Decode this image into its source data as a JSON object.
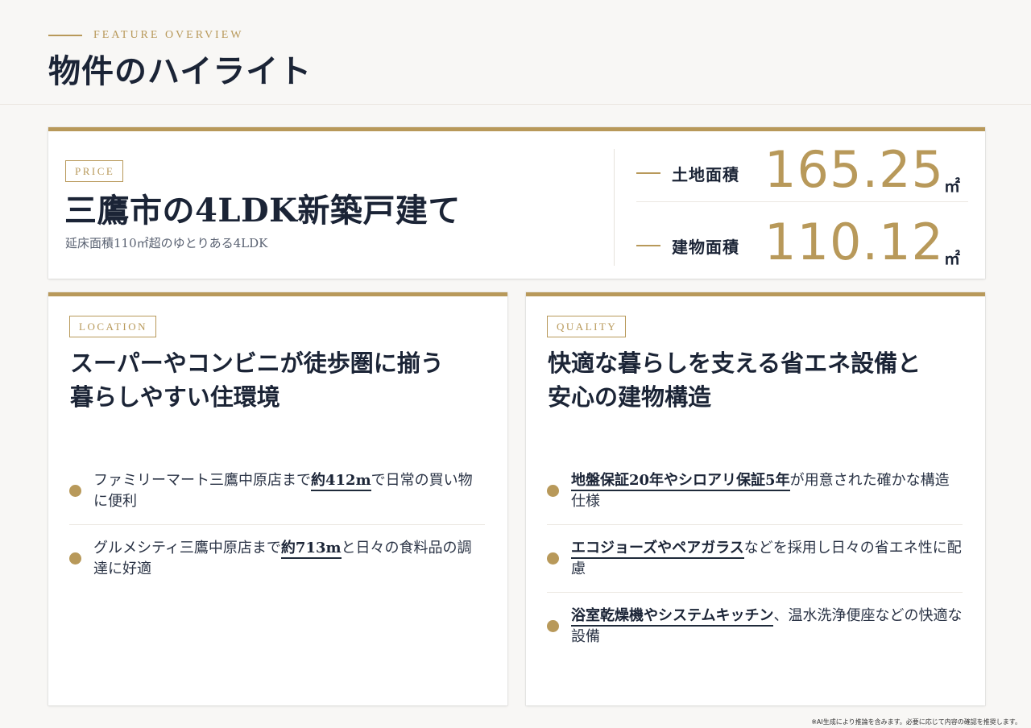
{
  "header": {
    "eyebrow": "FEATURE OVERVIEW",
    "title": "物件のハイライト"
  },
  "price_card": {
    "tag": "PRICE",
    "title": "三鷹市の4LDK新築戸建て",
    "subtitle": "延床面積110㎡超のゆとりある4LDK",
    "stats": [
      {
        "label": "土地面積",
        "value": "165.25",
        "unit": "㎡"
      },
      {
        "label": "建物面積",
        "value": "110.12",
        "unit": "㎡"
      }
    ]
  },
  "location_card": {
    "tag": "LOCATION",
    "title_line1": "スーパーやコンビニが徒歩圏に揃う",
    "title_line2": "暮らしやすい住環境",
    "items": [
      {
        "before": "ファミリーマート三鷹中原店まで",
        "highlight": "約412m",
        "after": "で日常の買い物に便利"
      },
      {
        "before": "グルメシティ三鷹中原店まで",
        "highlight": "約713m",
        "after": "と日々の食料品の調達に好適"
      }
    ]
  },
  "quality_card": {
    "tag": "QUALITY",
    "title_line1": "快適な暮らしを支える省エネ設備と",
    "title_line2": "安心の建物構造",
    "items": [
      {
        "before": "",
        "highlight": "地盤保証20年やシロアリ保証5年",
        "after": "が用意された確かな構造仕様"
      },
      {
        "before": "",
        "highlight": "エコジョーズやペアガラス",
        "after": "などを採用し日々の省エネ性に配慮"
      },
      {
        "before": "",
        "highlight": "浴室乾燥機やシステムキッチン",
        "after": "、温水洗浄便座などの快適な設備"
      }
    ]
  },
  "footnote": "※AI生成により推論を含みます。必要に応じて内容の確認を推奨します。",
  "colors": {
    "accent": "#b8995a",
    "navy": "#1b2436",
    "background": "#f8f7f5"
  }
}
